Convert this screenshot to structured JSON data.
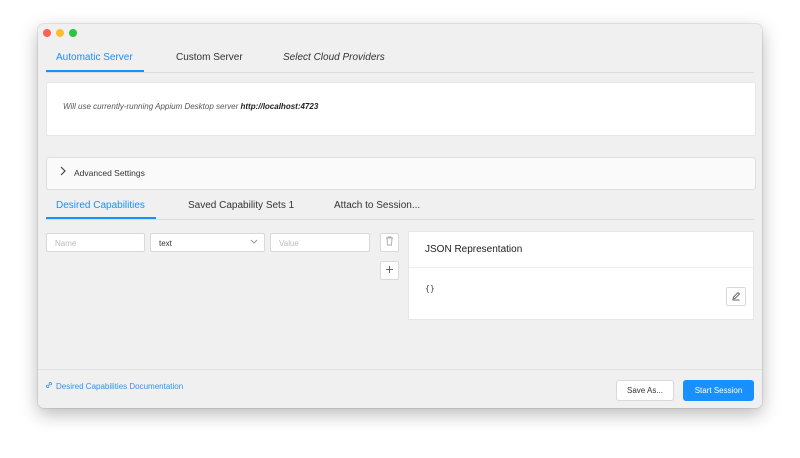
{
  "window": {
    "controls": [
      "close",
      "minimize",
      "maximize"
    ]
  },
  "server_tabs": [
    {
      "label": "Automatic Server",
      "active": true
    },
    {
      "label": "Custom Server",
      "active": false
    },
    {
      "label": "Select Cloud Providers",
      "active": false
    }
  ],
  "server": {
    "message": "Will use currently-running Appium Desktop server ",
    "url": "http://localhost:4723"
  },
  "advanced": {
    "label": "Advanced Settings",
    "icon": "chevron-right-icon"
  },
  "cap_tabs": [
    {
      "label": "Desired Capabilities",
      "active": true
    },
    {
      "label": "Saved Capability Sets 1",
      "active": false
    },
    {
      "label": "Attach to Session...",
      "active": false
    }
  ],
  "capability": {
    "name_placeholder": "Name",
    "type_value": "text",
    "value_placeholder": "Value"
  },
  "json": {
    "title": "JSON Representation",
    "content": "{}"
  },
  "footer": {
    "doc_link": "Desired Capabilities Documentation",
    "save_as": "Save As...",
    "start_session": "Start Session"
  },
  "colors": {
    "accent": "#1890ff",
    "link": "#3a8ee6"
  }
}
